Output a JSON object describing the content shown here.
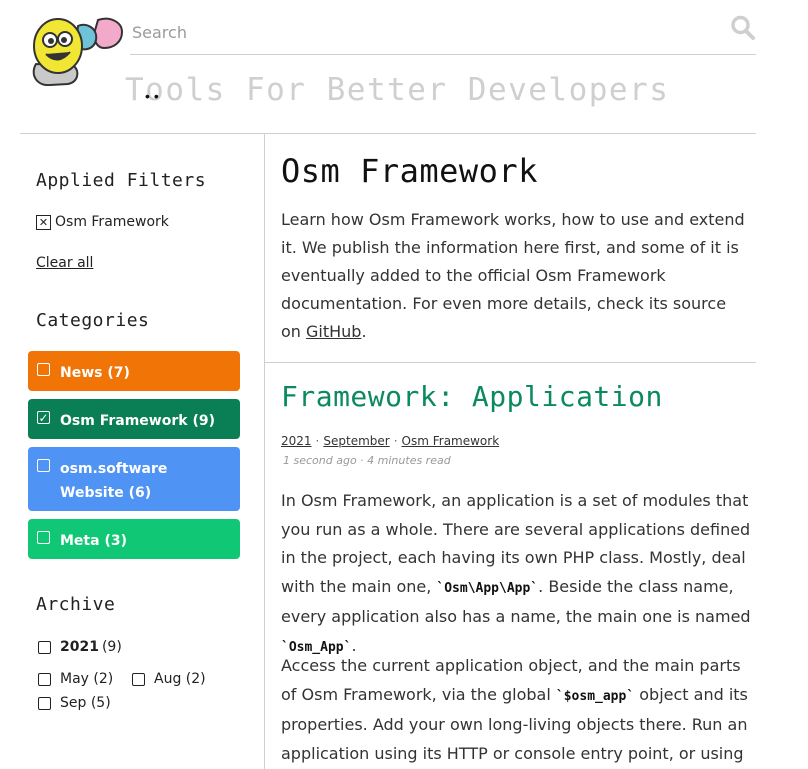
{
  "colors": {
    "news": "#f07406",
    "osm_framework": "#0a7e54",
    "website": "#4f93f5",
    "meta": "#10c775",
    "post_title": "#0b8a5e",
    "tagline": "#cfcfcf"
  },
  "header": {
    "logo_icon": "osm-logo-icon",
    "search": {
      "placeholder": "Search",
      "value": "",
      "icon": "search-icon"
    },
    "tagline": "Tools For Better Developers",
    "tagline_marks": "••"
  },
  "sidebar": {
    "applied_filters": {
      "heading": "Applied Filters",
      "filter_icon": "close-box-icon",
      "filter_icon_glyph": "✕",
      "filter_label": "Osm Framework",
      "clear_all": "Clear all"
    },
    "categories": {
      "heading": "Categories",
      "checked_glyph": "✓",
      "items": [
        {
          "label": "News (7)",
          "checked": false
        },
        {
          "label": "Osm Framework (9)",
          "checked": true
        },
        {
          "label": "osm.software Website (6)",
          "checked": false
        },
        {
          "label": "Meta (3)",
          "checked": false
        }
      ]
    },
    "archive": {
      "heading": "Archive",
      "year": {
        "label": "2021",
        "count": "(9)"
      },
      "months": [
        {
          "label": "May (2)"
        },
        {
          "label": "Aug (2)"
        },
        {
          "label": "Sep (5)"
        }
      ]
    }
  },
  "main": {
    "title": "Osm Framework",
    "intro": {
      "text": "Learn how Osm Framework works, how to use and extend it. We publish the information here first, and some of it is eventually added to the official Osm Framework documentation. For even more details, check its source on ",
      "link": "GitHub",
      "end": "."
    },
    "post": {
      "title": "Framework: Application",
      "meta": {
        "year": "2021",
        "month": "September",
        "category": "Osm Framework",
        "sep": "·"
      },
      "timing": "1 second ago · 4 minutes read",
      "p1": {
        "a": "In Osm Framework, an application is a set of modules that you run as a whole. There are several applications defined in the project, each having its own PHP class. Mostly, deal with the main one, ",
        "code1": "`Osm\\App\\App`",
        "b": ". Beside the class name, every application also has a name, the main one is named ",
        "code2": "`Osm_App`",
        "c": "."
      },
      "p2": {
        "a": "Access the current application object, and the main parts of Osm Framework, via the global ",
        "code": "`$osm_app`",
        "b": " object and its properties. Add your own long-living objects there. Run an application using its HTTP or console entry point, or using"
      }
    }
  }
}
